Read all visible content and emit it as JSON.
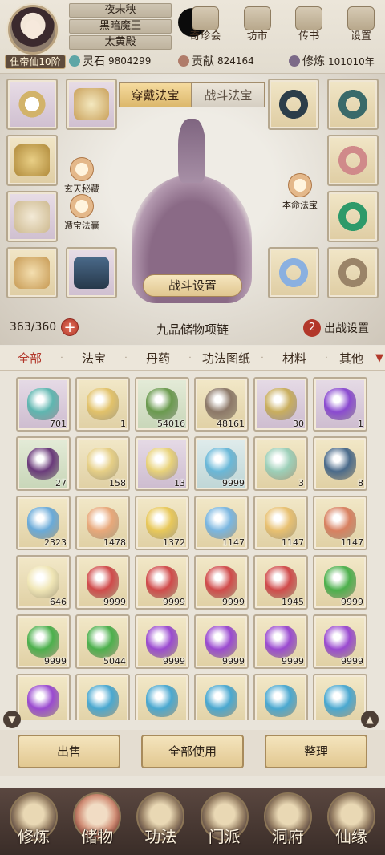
{
  "header": {
    "rank_label": "隹帝仙10阶",
    "titles": [
      "夜未秧",
      "黑暗魔王",
      "太黄殿"
    ],
    "top_icons": [
      {
        "label": "奇珍会",
        "icon": "treasure-icon"
      },
      {
        "label": "坊市",
        "icon": "market-icon"
      },
      {
        "label": "传书",
        "icon": "letter-icon"
      },
      {
        "label": "设置",
        "icon": "gear-icon"
      }
    ],
    "resources": [
      {
        "name": "灵石",
        "value": "9804299",
        "color": "#5fa6a6"
      },
      {
        "name": "贡献",
        "value": "824164",
        "color": "#b07c6a"
      },
      {
        "name": "修炼",
        "value": "101010年",
        "color": "#7c6a88"
      }
    ]
  },
  "equip": {
    "tabs": [
      "穿戴法宝",
      "战斗法宝"
    ],
    "active_tab": 0,
    "side_buttons": [
      {
        "label": "玄天秘藏"
      },
      {
        "label": "遁宝法囊"
      },
      {
        "label": "本命法宝"
      }
    ],
    "battle_setting_label": "战斗设置",
    "capacity": "363/360",
    "necklace_title": "九品储物项链",
    "deploy_count": "2",
    "deploy_label": "出战设置"
  },
  "categories": [
    "全部",
    "法宝",
    "丹药",
    "功法图纸",
    "材料",
    "其他"
  ],
  "active_category": 0,
  "items": [
    {
      "count": "701",
      "q": "purple",
      "color": "#5fb6b0"
    },
    {
      "count": "1",
      "q": "gold",
      "color": "#e2c26a"
    },
    {
      "count": "54016",
      "q": "green",
      "color": "#6a9a4e"
    },
    {
      "count": "48161",
      "q": "gold",
      "color": "#8c7868"
    },
    {
      "count": "30",
      "q": "purple",
      "color": "#c9ae5e"
    },
    {
      "count": "1",
      "q": "purple",
      "color": "#8a4ad0"
    },
    {
      "count": "27",
      "q": "green",
      "color": "#6a3a7a"
    },
    {
      "count": "158",
      "q": "gold",
      "color": "#e6cf86"
    },
    {
      "count": "13",
      "q": "purple",
      "color": "#e8d27a"
    },
    {
      "count": "9999",
      "q": "blue",
      "color": "#6ab8d8"
    },
    {
      "count": "3",
      "q": "gold",
      "color": "#9ccfb8"
    },
    {
      "count": "8",
      "q": "gold",
      "color": "#4a6a8a"
    },
    {
      "count": "2323",
      "q": "gold",
      "color": "#6aaad8"
    },
    {
      "count": "1478",
      "q": "gold",
      "color": "#e8a87a"
    },
    {
      "count": "1372",
      "q": "gold",
      "color": "#e8c85a"
    },
    {
      "count": "1147",
      "q": "gold",
      "color": "#7ab6e0"
    },
    {
      "count": "1147",
      "q": "gold",
      "color": "#e8c070"
    },
    {
      "count": "1147",
      "q": "gold",
      "color": "#d88060"
    },
    {
      "count": "646",
      "q": "gold",
      "color": "#f0e6b6"
    },
    {
      "count": "9999",
      "q": "gold",
      "color": "#d04a4a"
    },
    {
      "count": "9999",
      "q": "gold",
      "color": "#d04a4a"
    },
    {
      "count": "9999",
      "q": "gold",
      "color": "#d04a4a"
    },
    {
      "count": "1945",
      "q": "gold",
      "color": "#d04a4a"
    },
    {
      "count": "9999",
      "q": "gold",
      "color": "#4cb04c"
    },
    {
      "count": "9999",
      "q": "gold",
      "color": "#4cb04c"
    },
    {
      "count": "5044",
      "q": "gold",
      "color": "#4cb04c"
    },
    {
      "count": "9999",
      "q": "gold",
      "color": "#9a4ad0"
    },
    {
      "count": "9999",
      "q": "gold",
      "color": "#9a4ad0"
    },
    {
      "count": "9999",
      "q": "gold",
      "color": "#9a4ad0"
    },
    {
      "count": "9999",
      "q": "gold",
      "color": "#9a4ad0"
    },
    {
      "count": "",
      "q": "gold",
      "color": "#9a4ad0"
    },
    {
      "count": "",
      "q": "gold",
      "color": "#4aa8d0"
    },
    {
      "count": "",
      "q": "gold",
      "color": "#4aa8d0"
    },
    {
      "count": "",
      "q": "gold",
      "color": "#4aa8d0"
    },
    {
      "count": "",
      "q": "gold",
      "color": "#4aa8d0"
    },
    {
      "count": "",
      "q": "gold",
      "color": "#4aa8d0"
    }
  ],
  "actions": [
    "出售",
    "全部使用",
    "整理"
  ],
  "nav": [
    {
      "label": "修炼",
      "icon": "cultivate-icon"
    },
    {
      "label": "储物",
      "icon": "storage-icon"
    },
    {
      "label": "功法",
      "icon": "scroll-icon"
    },
    {
      "label": "门派",
      "icon": "sect-icon"
    },
    {
      "label": "洞府",
      "icon": "cave-icon"
    },
    {
      "label": "仙缘",
      "icon": "fate-icon"
    }
  ],
  "active_nav": 1
}
